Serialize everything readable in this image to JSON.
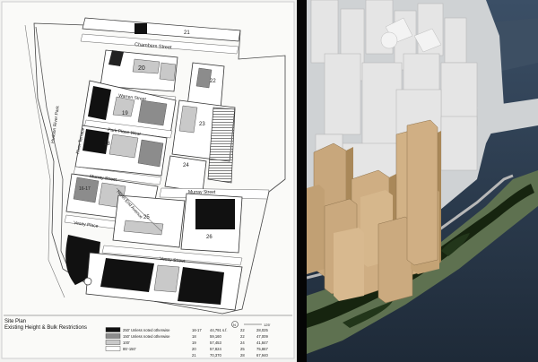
{
  "site_plan": {
    "caption_title": "Site Plan",
    "caption_subtitle": "Existing Height & Bulk Restrictions",
    "streets": {
      "chambers": "Chambers Street",
      "warren": "Warren Street",
      "park_place_west": "Park Place West",
      "murray": "Murray Street",
      "murray_east": "Murray Street",
      "vesey_place": "Vesey Place",
      "vesey": "Vesey Street",
      "river_terrace": "River Terrace",
      "north_end_avenue": "North End Avenue",
      "hudson_river_park": "Hudson River Park"
    },
    "parcels": {
      "p21": "21",
      "p20": "20",
      "p22": "22",
      "p19": "19",
      "p23": "23",
      "p18": "18",
      "p24": "24",
      "p16_17": "16-17",
      "p25": "25",
      "p26": "26"
    },
    "legend": [
      {
        "swatch": "#111111",
        "label": "250' Unless noted otherwise",
        "site": "16-17",
        "area": "44,791 s.f.",
        "far": "22",
        "total": "28,025"
      },
      {
        "swatch": "#8c8c8c",
        "label": "150' Unless noted otherwise",
        "site": "18",
        "area": "59,160",
        "far": "22",
        "total": "47,009"
      },
      {
        "swatch": "#c9c9c9",
        "label": "100'",
        "site": "19",
        "area": "57,453",
        "far": "24",
        "total": "41,847"
      },
      {
        "swatch": "#ffffff",
        "label": "85'-150'",
        "site": "20",
        "area": "57,824",
        "far": "25",
        "total": "75,867"
      },
      {
        "swatch": "#ffffff",
        "label": "",
        "site": "21",
        "area": "70,370",
        "far": "28",
        "total": "67,940"
      }
    ],
    "scale_label": "125'",
    "north_label": "N"
  },
  "model_view": {
    "colors": {
      "water": "#2c3d52",
      "park": "#5e7150",
      "trees": "#16240f",
      "towers_new": "#c8a77c",
      "towers_existing": "#e3e3e3"
    }
  }
}
